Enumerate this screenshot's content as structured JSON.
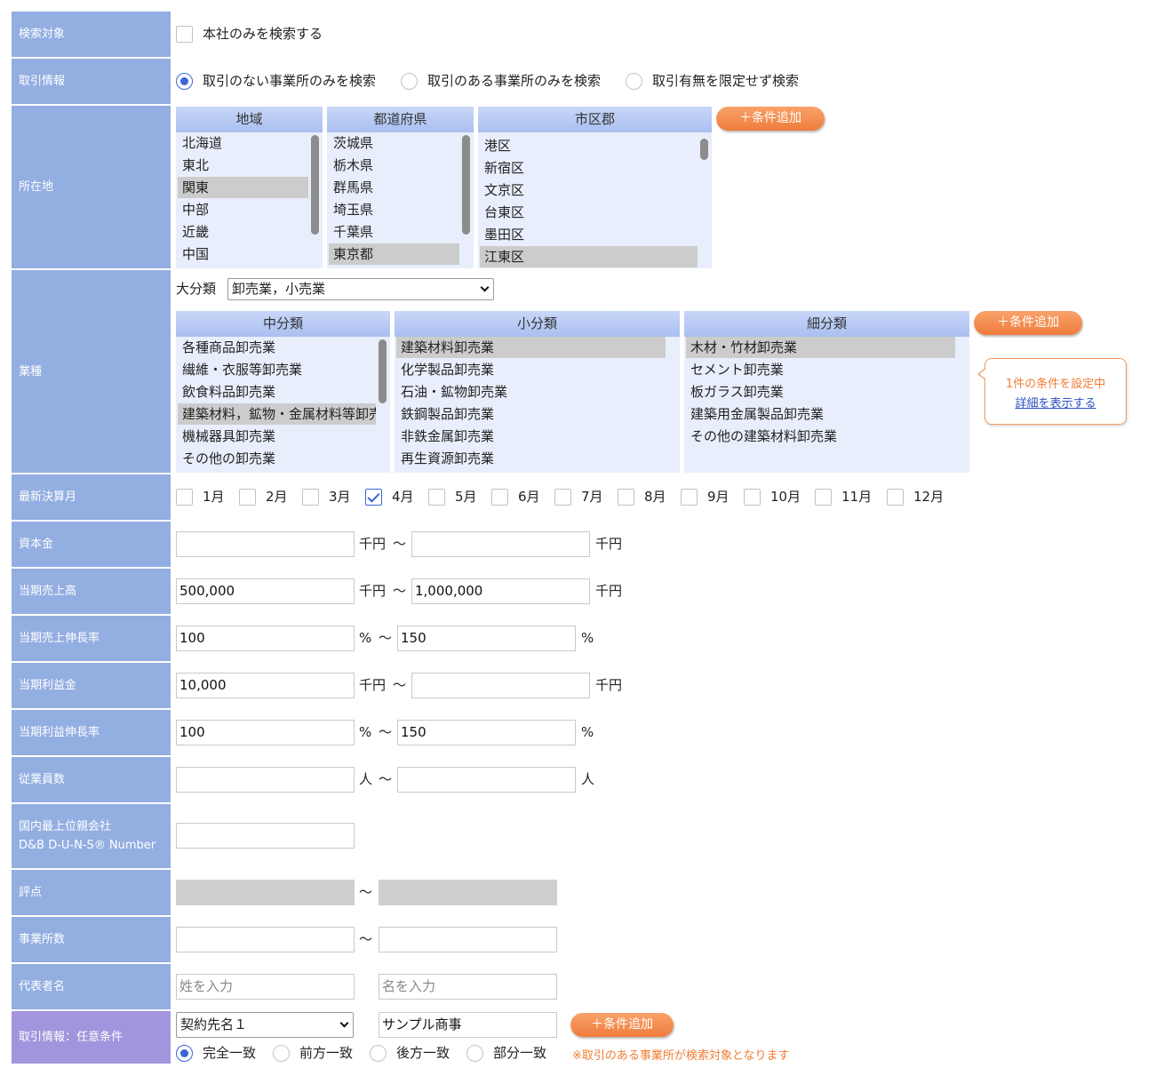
{
  "labels": {
    "search_target": "検索対象",
    "trade_info": "取引情報",
    "location": "所在地",
    "industry": "業種",
    "fiscal_month": "最新決算月",
    "capital": "資本金",
    "sales": "当期売上高",
    "sales_growth": "当期売上伸長率",
    "profit": "当期利益金",
    "profit_growth": "当期利益伸長率",
    "employees": "従業員数",
    "parent_line1": "国内最上位親会社",
    "parent_line2": "D&B D-U-N-S® Number",
    "score": "評点",
    "offices": "事業所数",
    "representative": "代表者名",
    "trade_optional": "取引情報：任意条件"
  },
  "search_target": {
    "checkbox_label": "本社のみを検索する",
    "checked": false
  },
  "trade_info": {
    "options": [
      "取引のない事業所のみを検索",
      "取引のある事業所のみを検索",
      "取引有無を限定せず検索"
    ],
    "selected": 0
  },
  "location": {
    "region": {
      "header": "地域",
      "items": [
        "北海道",
        "東北",
        "関東",
        "中部",
        "近畿",
        "中国"
      ],
      "selected": 2
    },
    "prefecture": {
      "header": "都道府県",
      "items": [
        "茨城県",
        "栃木県",
        "群馬県",
        "埼玉県",
        "千葉県",
        "東京都"
      ],
      "selected": 5
    },
    "city": {
      "header": "市区郡",
      "items": [
        "港区",
        "新宿区",
        "文京区",
        "台東区",
        "墨田区",
        "江東区"
      ],
      "selected": 5
    },
    "add_button": "条件追加"
  },
  "industry": {
    "major_label": "大分類",
    "major_value": "卸売業，小売業",
    "medium": {
      "header": "中分類",
      "items": [
        "各種商品卸売業",
        "繊維・衣服等卸売業",
        "飲食料品卸売業",
        "建築材料，鉱物・金属材料等卸売業",
        "機械器具卸売業",
        "その他の卸売業"
      ],
      "selected": 3
    },
    "minor": {
      "header": "小分類",
      "items": [
        "建築材料卸売業",
        "化学製品卸売業",
        "石油・鉱物卸売業",
        "鉄鋼製品卸売業",
        "非鉄金属卸売業",
        "再生資源卸売業"
      ],
      "selected": 0
    },
    "detail": {
      "header": "細分類",
      "items": [
        "木材・竹材卸売業",
        "セメント卸売業",
        "板ガラス卸売業",
        "建築用金属製品卸売業",
        "その他の建築材料卸売業"
      ],
      "selected": 0
    },
    "add_button": "条件追加",
    "tooltip_status": "1件の条件を設定中",
    "tooltip_link": "詳細を表示する"
  },
  "fiscal_months": {
    "items": [
      "1月",
      "2月",
      "3月",
      "4月",
      "5月",
      "6月",
      "7月",
      "8月",
      "9月",
      "10月",
      "11月",
      "12月"
    ],
    "checked": [
      3
    ]
  },
  "capital": {
    "from": "",
    "to": "",
    "unit": "千円",
    "sep": "～"
  },
  "sales": {
    "from": "500,000",
    "to": "1,000,000",
    "unit": "千円",
    "sep": "～"
  },
  "sales_growth": {
    "from": "100",
    "to": "150",
    "unit": "%",
    "sep": "～"
  },
  "profit": {
    "from": "10,000",
    "to": "",
    "unit": "千円",
    "sep": "～"
  },
  "profit_growth": {
    "from": "100",
    "to": "150",
    "unit": "%",
    "sep": "～"
  },
  "employees": {
    "from": "",
    "to": "",
    "unit": "人",
    "sep": "～"
  },
  "parent": {
    "value": ""
  },
  "score": {
    "sep": "～"
  },
  "offices": {
    "from": "",
    "to": "",
    "sep": "～"
  },
  "representative": {
    "last_placeholder": "姓を入力",
    "first_placeholder": "名を入力"
  },
  "trade_optional": {
    "field_select": "契約先名１",
    "value": "サンプル商事",
    "add_button": "条件追加",
    "match_options": [
      "完全一致",
      "前方一致",
      "後方一致",
      "部分一致"
    ],
    "match_selected": 0,
    "note": "※取引のある事業所が検索対象となります"
  },
  "colors": {
    "label_bg": "#93aee1",
    "label_purple": "#a294dd",
    "accent": "#ef7c3c",
    "check": "#3a66d6"
  }
}
